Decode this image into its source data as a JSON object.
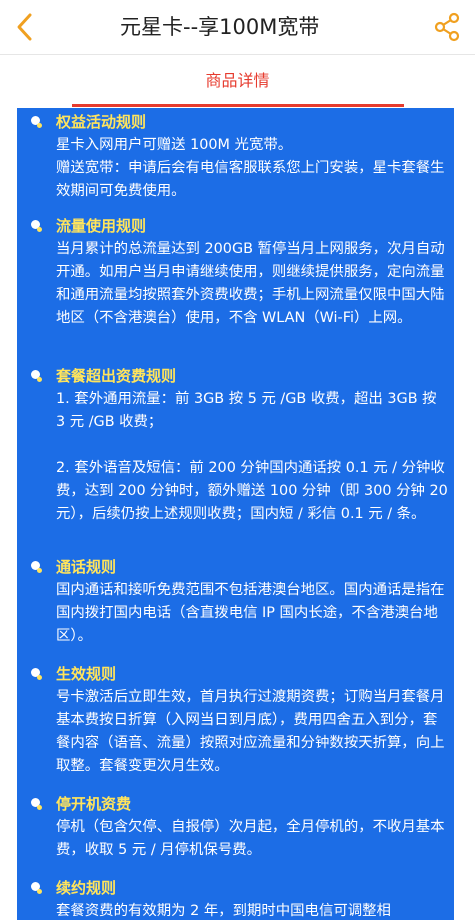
{
  "header": {
    "title": "元星卡--享100M宽带",
    "back_icon": "chevron-left-icon",
    "share_icon": "share-icon",
    "accent": "#f0a020"
  },
  "tabs": {
    "active_label": "商品详情",
    "accent": "#e63b2e"
  },
  "content": {
    "background": "#1c6de6",
    "heading_color": "#ffe45c",
    "sections": [
      {
        "title": "权益活动规则",
        "paragraphs": [
          "星卡入网用户可赠送 100M 光宽带。",
          "赠送宽带：申请后会有电信客服联系您上门安装，星卡套餐生效期间可免费使用。"
        ]
      },
      {
        "title": "流量使用规则",
        "paragraphs": [
          "当月累计的总流量达到 200GB 暂停当月上网服务，次月自动开通。如用户当月申请继续使用，则继续提供服务，定向流量和通用流量均按照套外资费收费；手机上网流量仅限中国大陆地区（不含港澳台）使用，不含 WLAN（Wi-Fi）上网。"
        ]
      },
      {
        "title": "套餐超出资费规则",
        "paragraphs": [
          "1. 套外通用流量：前 3GB 按 5 元 /GB 收费，超出 3GB 按 3 元 /GB 收费；",
          "2. 套外语音及短信：前 200 分钟国内通话按 0.1 元 / 分钟收费，达到 200 分钟时，额外赠送 100 分钟（即 300 分钟 20 元），后续仍按上述规则收费；国内短 / 彩信 0.1 元 / 条。"
        ]
      },
      {
        "title": "通话规则",
        "paragraphs": [
          "国内通话和接听免费范围不包括港澳台地区。国内通话是指在国内拨打国内电话（含直拨电信 IP 国内长途，不含港澳台地区）。"
        ]
      },
      {
        "title": "生效规则",
        "paragraphs": [
          "号卡激活后立即生效，首月执行过渡期资费；订购当月套餐月基本费按日折算（入网当日到月底），费用四舍五入到分，套餐内容（语音、流量）按照对应流量和分钟数按天折算，向上取整。套餐变更次月生效。"
        ]
      },
      {
        "title": "停开机资费",
        "paragraphs": [
          "停机（包含欠停、自报停）次月起，全月停机的，不收月基本费，收取 5 元 / 月停机保号费。"
        ]
      },
      {
        "title": "续约规则",
        "paragraphs": [
          "套餐资费的有效期为 2 年，到期时中国电信可调整相"
        ]
      }
    ]
  }
}
